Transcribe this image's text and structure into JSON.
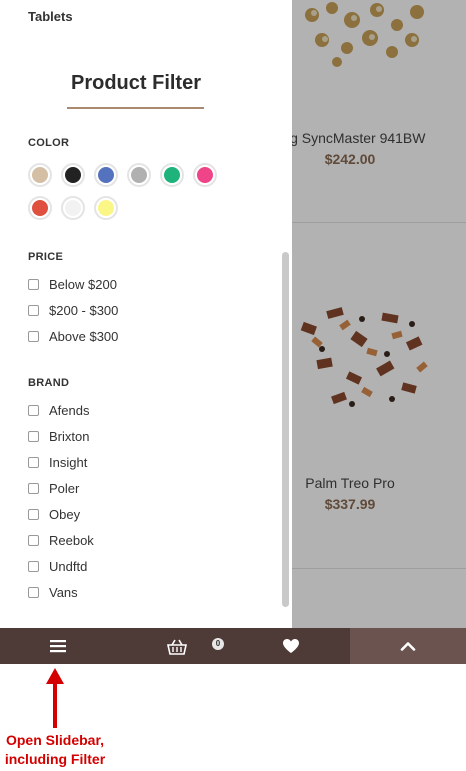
{
  "sidebar": {
    "category_link": "Tablets",
    "filter_title": "Product Filter",
    "color": {
      "heading": "COLOR",
      "swatches": [
        "#d4bfa4",
        "#222222",
        "#5472bd",
        "#b0b0b0",
        "#1db37a",
        "#ef4487",
        "#e0503f",
        "#f2f2f2",
        "#fbf787"
      ]
    },
    "price": {
      "heading": "PRICE",
      "options": [
        "Below $200",
        "$200 - $300",
        "Above $300"
      ]
    },
    "brand": {
      "heading": "BRAND",
      "options": [
        "Afends",
        "Brixton",
        "Insight",
        "Poler",
        "Obey",
        "Reebok",
        "Undftd",
        "Vans"
      ]
    }
  },
  "products": [
    {
      "name": "ung SyncMaster 941BW",
      "price": "$242.00"
    },
    {
      "name": "Palm Treo Pro",
      "price": "$337.99"
    }
  ],
  "toolbar": {
    "menu_icon": "hamburger-menu-icon",
    "cart_icon": "shopping-basket-icon",
    "cart_count": "0",
    "wishlist_icon": "heart-icon",
    "top_icon": "chevron-up-icon"
  },
  "annotation": {
    "line1": "Open Slidebar,",
    "line2": "including Filter"
  },
  "colors": {
    "toolbar": "#4e3b38",
    "accent": "#a98a6e",
    "price": "#8a6a52",
    "annotation": "#d40000"
  }
}
